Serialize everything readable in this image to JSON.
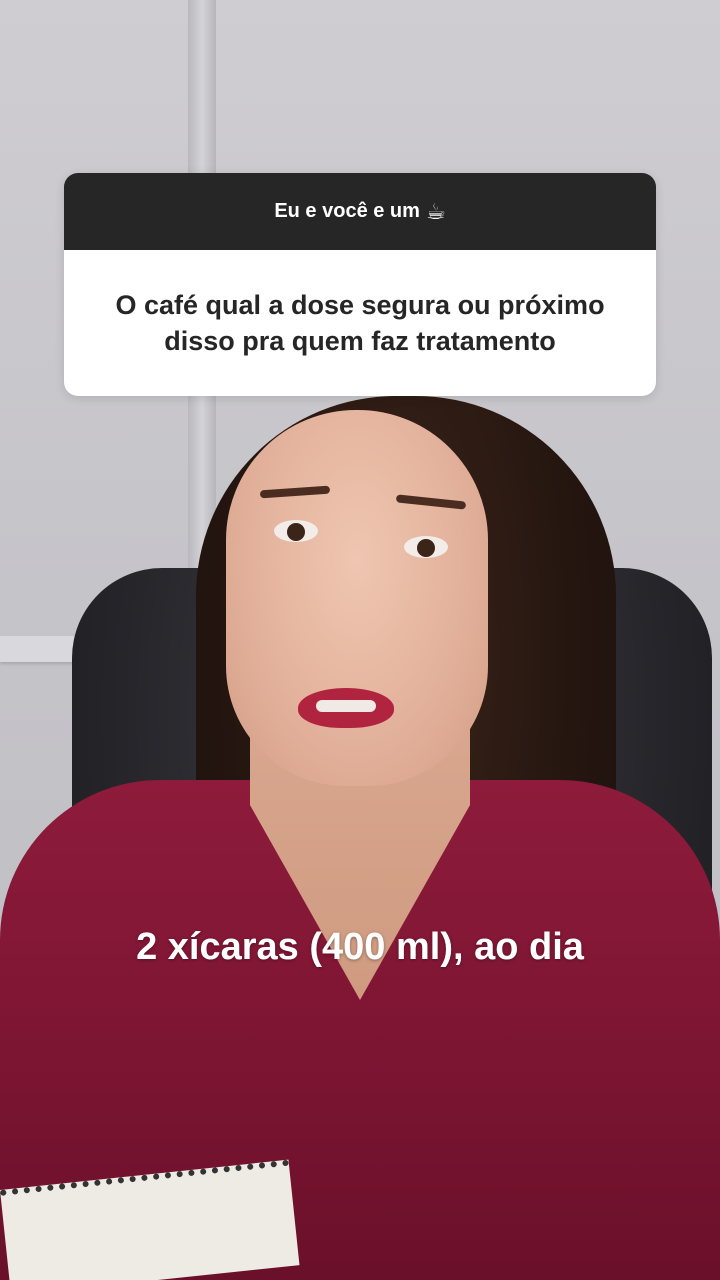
{
  "question_sticker": {
    "prompt": "Eu e você e um",
    "prompt_icon": "coffee-cup-icon",
    "prompt_icon_glyph": "☕",
    "question": "O café qual a dose segura ou próximo disso pra quem faz tratamento"
  },
  "caption": {
    "text": "2 xícaras (400 ml), ao dia"
  },
  "colors": {
    "sticker_header_bg": "#262626",
    "sticker_body_bg": "#ffffff",
    "caption_text": "#ffffff",
    "sweater": "#8e1b3b"
  }
}
